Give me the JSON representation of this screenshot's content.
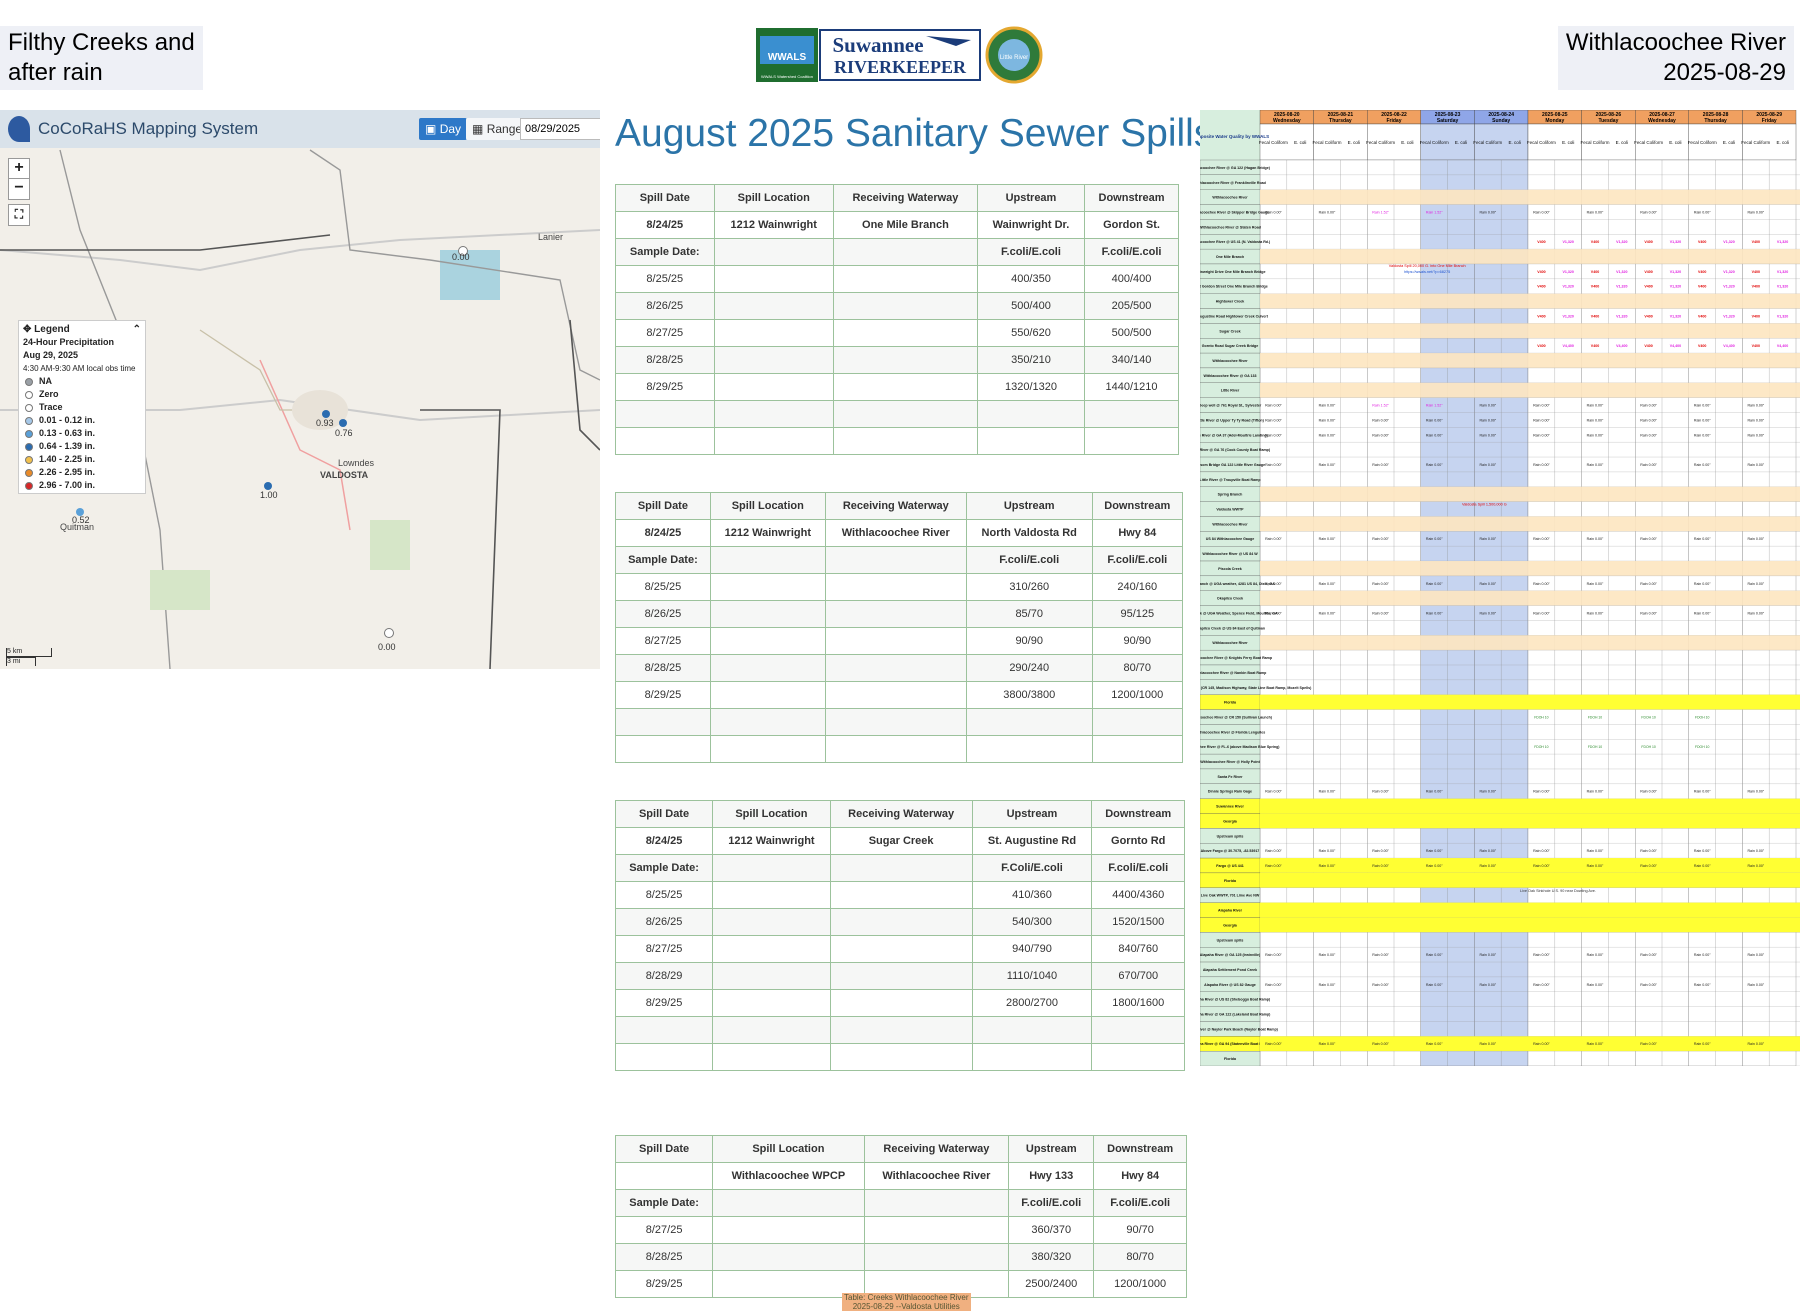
{
  "header": {
    "left_title_1": "Filthy Creeks and",
    "left_title_2": "after rain",
    "right_title_1": "Withlacoochee River",
    "right_title_2": "2025-08-29"
  },
  "logo": {
    "text_top": "Suwannee",
    "text_bottom": "RIVERKEEPER",
    "badge": "WWALS",
    "tag": "WWALS Watershed Coalition",
    "seal_text": "Little River"
  },
  "map": {
    "title": "CoCoRaHS Mapping System",
    "day_label": "Day",
    "range_label": "Range",
    "date_value": "08/29/2025",
    "zoom_in": "+",
    "zoom_out": "−",
    "fullscreen": "⛶",
    "legend": {
      "title": "Legend",
      "subtitle": "24-Hour Precipitation",
      "date": "Aug 29, 2025",
      "time": "4:30 AM-9:30 AM local obs time",
      "items": [
        {
          "label": "NA",
          "color": "#9aa0a6"
        },
        {
          "label": "Zero",
          "color": "#ffffff"
        },
        {
          "label": "Trace",
          "color": "#ffffff"
        },
        {
          "label": "0.01 - 0.12 in.",
          "color": "#a6c8e8"
        },
        {
          "label": "0.13 - 0.63 in.",
          "color": "#5aa0d8"
        },
        {
          "label": "0.64 - 1.39 in.",
          "color": "#2b6cb0"
        },
        {
          "label": "1.40 - 2.25 in.",
          "color": "#f2c14e"
        },
        {
          "label": "2.26 - 2.95 in.",
          "color": "#e98b2a"
        },
        {
          "label": "2.96 - 7.00 in.",
          "color": "#d62728"
        }
      ]
    },
    "places": {
      "lanier": "Lanier",
      "lowndes": "Lowndes",
      "valdosta": "VALDOSTA",
      "quitman": "Quitman"
    },
    "readings": [
      "0.00",
      "0.93",
      "0.76",
      "1.00",
      "0.52",
      "0.00"
    ],
    "scale_km": "5 km",
    "scale_mi": "3 mi"
  },
  "spills": {
    "heading": "August 2025 Sanitary Sewer Spills",
    "tables": [
      {
        "headers": [
          "Spill Date",
          "Spill Location",
          "Receiving Waterway",
          "Upstream",
          "Downstream"
        ],
        "spill": [
          "8/24/25",
          "1212 Wainwright",
          "One Mile Branch",
          "Wainwright Dr.",
          "Gordon St."
        ],
        "sample": [
          "Sample Date:",
          "",
          "",
          "F.coli/E.coli",
          "F.coli/E.coli"
        ],
        "rows": [
          [
            "8/25/25",
            "400/350",
            "400/400"
          ],
          [
            "8/26/25",
            "500/400",
            "205/500"
          ],
          [
            "8/27/25",
            "550/620",
            "500/500"
          ],
          [
            "8/28/25",
            "350/210",
            "340/140"
          ],
          [
            "8/29/25",
            "1320/1320",
            "1440/1210"
          ]
        ]
      },
      {
        "headers": [
          "Spill Date",
          "Spill Location",
          "Receiving Waterway",
          "Upstream",
          "Downstream"
        ],
        "spill": [
          "8/24/25",
          "1212 Wainwright",
          "Withlacoochee River",
          "North Valdosta Rd",
          "Hwy 84"
        ],
        "sample": [
          "Sample Date:",
          "",
          "",
          "F.coli/E.coli",
          "F.coli/E.coli"
        ],
        "rows": [
          [
            "8/25/25",
            "310/260",
            "240/160"
          ],
          [
            "8/26/25",
            "85/70",
            "95/125"
          ],
          [
            "8/27/25",
            "90/90",
            "90/90"
          ],
          [
            "8/28/25",
            "290/240",
            "80/70"
          ],
          [
            "8/29/25",
            "3800/3800",
            "1200/1000"
          ]
        ]
      },
      {
        "headers": [
          "Spill Date",
          "Spill Location",
          "Receiving Waterway",
          "Upstream",
          "Downstream"
        ],
        "spill": [
          "8/24/25",
          "1212 Wainwright",
          "Sugar Creek",
          "St. Augustine Rd",
          "Gornto Rd"
        ],
        "sample": [
          "Sample Date:",
          "",
          "",
          "F.Coli/E.coli",
          "F.coli/E.coli"
        ],
        "rows": [
          [
            "8/25/25",
            "410/360",
            "4400/4360"
          ],
          [
            "8/26/25",
            "540/300",
            "1520/1500"
          ],
          [
            "8/27/25",
            "940/790",
            "840/760"
          ],
          [
            "8/28/29",
            "1110/1040",
            "670/700"
          ],
          [
            "8/29/25",
            "2800/2700",
            "1800/1600"
          ]
        ]
      },
      {
        "headers": [
          "Spill Date",
          "Spill Location",
          "Receiving Waterway",
          "Upstream",
          "Downstream"
        ],
        "spill": [
          "",
          "Withlacoochee WPCP",
          "Withlacoochee River",
          "Hwy 133",
          "Hwy 84"
        ],
        "sample": [
          "Sample Date:",
          "",
          "",
          "F.coli/E.coli",
          "F.coli/E.coli"
        ],
        "rows": [
          [
            "8/27/25",
            "360/370",
            "90/70"
          ],
          [
            "8/28/25",
            "380/320",
            "80/70"
          ],
          [
            "8/29/25",
            "2500/2400",
            "1200/1000"
          ]
        ]
      }
    ],
    "caption_1": "Table: Creeks Withlacoochee River",
    "caption_2": "2025-08-29 --Valdosta Utilities"
  },
  "composite": {
    "corner_label": "Composite Water Quality by WWALS",
    "dates": [
      "2025-08-20",
      "2025-08-21",
      "2025-08-22",
      "2025-08-23",
      "2025-08-24",
      "2025-08-25",
      "2025-08-26",
      "2025-08-27",
      "2025-08-28",
      "2025-08-29"
    ],
    "days": [
      "Wednesday",
      "Thursday",
      "Friday",
      "Saturday",
      "Sunday",
      "Monday",
      "Tuesday",
      "Wednesday",
      "Thursday",
      "Friday"
    ],
    "col_fecal": "Fecal Coliform",
    "col_ecoli": "E. coli",
    "sites": [
      "Withlacoochee River @ GA 122 (Hagan Bridge)",
      "Withlacoochee River @ Franklinville Road",
      "Withlacoochee River",
      "Withlacoochee River @ Skipper Bridge Gauge",
      "Withlacoochee River @ Staten Road",
      "Withlacoochee River @ US 41 (N. Valdosta Rd.)",
      "One Mile Branch",
      "Wainwright Drive One Mile Branch Bridge",
      "West Gordon Street One Mile Branch Bridge",
      "Hightower Creek",
      "St. Augustine Road Hightower Creek Culvert",
      "Sugar Creek",
      "Gornto Road Sugar Creek Bridge",
      "Withlacoochee River",
      "Withlacoochee River @ GA 133",
      "Little River",
      "Deep well @ 761 Royal St., Sylvester",
      "Little River @ Upper Ty Ty Road (Tifton)",
      "Little River @ GA 37 (Adel-Moultrie Landing)",
      "Little River @ GA 76 (Cook County Boat Ramp)",
      "Folsom Bridge GA 122 Little River Gauge",
      "Little River @ Troupville Boat Ramp",
      "Spring Branch",
      "Valdosta WWTP",
      "Withlacoochee River",
      "US 84 Withlacoochee Gauge",
      "Withlacoochee River @ US 84 W",
      "Piscola Creek",
      "Allen. Branch @ UGA weather, 4281 US 84, Dixie, GA",
      "Okapilco Creek",
      "Little Creek @ UGA Weather, Spence Field, Moultrie, GA",
      "Okapilco Creek @ US 84 East of Quitman",
      "Withlacoochee River",
      "Withlacoochee River @ Knights Ferry Boat Ramp",
      "Withlacoochee River @ Nankin Boat Ramp",
      "Withlacoochee River @ GA 31 (CR 145, Madison Highway, State Line Boat Ramp, Mozelt Spells)",
      "Florida",
      "Withlacoochee River @ CR 150 (Sullivan Launch)",
      "Withlacoochee River @ Florida Lenguiles",
      "Withlacoochee River @ FL-6 (above Madison Blue Spring)",
      "Withlacoochee River @ Holly Point",
      "Santa Fe River",
      "Dinnie Springs Rain Gage",
      "Suwannee River",
      "Georgia",
      "Upstream spills",
      "Above Fargo @ 30.7075, -82.53917",
      "Fargo @ US 441",
      "Florida",
      "Live Oak WWTP, 701 Lime Ave NW",
      "Alapaha River",
      "Georgia",
      "Upstream spills",
      "Alapaha River @ GA 125 (Irwinville)",
      "Alapaha Settlement Pond Creek",
      "Alapaha River @ US 82 Gauge",
      "Alapaha River @ US 82 (Sheboggo Boat Ramp)",
      "Alapaha River @ GA 122 (Lakeland Boat Ramp)",
      "Alapaha River @ Naylor Park Beach (Naylor Boat Ramp)",
      "Alapaha River @ GA 94 (Statenville Boat Ramp)",
      "Florida"
    ],
    "notes": {
      "valdosta_spill_1": "Valdosta Spill 20,000 G. into One Mile Branch",
      "valdosta_spill_2": "Valdosta Spill 1,500,000 G",
      "link": "https://wwals.net/?p=68275",
      "live_oak": "Live Oak Sinkhole U.S. 90 near Dowling Ave."
    },
    "cells": {
      "rain0": "Rain 0.00\"",
      "rain1": "Rain 1.52\"",
      "rain2": "Rain 0.38\"",
      "v1": "V310",
      "v2": "V400",
      "v3": "V500",
      "v4": "V1,320",
      "v5": "V4,400",
      "fdoh": "FDOH 10"
    },
    "colors": {
      "date_header": "#f0a060",
      "weekend": "#c6d4f0",
      "site_col": "#d7eede",
      "highlight_yellow": "#ffff33",
      "highlight_orange": "#fde6c0",
      "highlight_pink": "#f6d0d0",
      "red_text": "#e00000",
      "magenta_text": "#e020e0",
      "orange_text": "#e08000",
      "green_text": "#2a8a2a"
    }
  }
}
